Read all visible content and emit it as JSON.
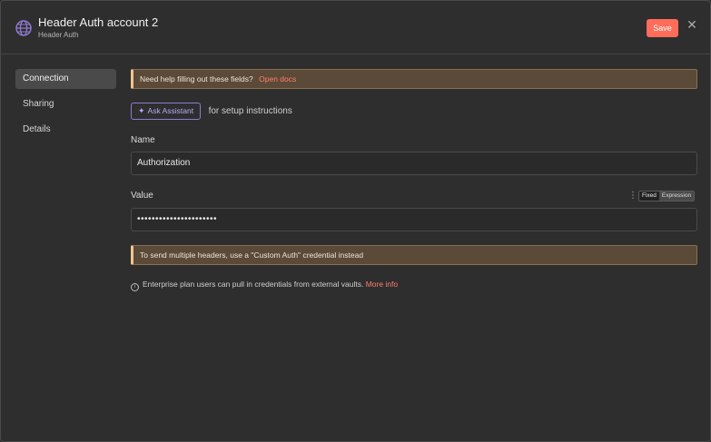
{
  "header": {
    "title": "Header Auth account 2",
    "subtitle": "Header Auth",
    "save_label": "Save",
    "icon": "globe-icon",
    "close_icon": "close-icon"
  },
  "sidebar": {
    "items": [
      {
        "label": "Connection",
        "active": true
      },
      {
        "label": "Sharing",
        "active": false
      },
      {
        "label": "Details",
        "active": false
      }
    ]
  },
  "notice": {
    "text": "Need help filling out these fields?",
    "link": "Open docs"
  },
  "assistant": {
    "button_label": "Ask Assistant",
    "suffix": "for setup instructions"
  },
  "fields": {
    "name_label": "Name",
    "name_value": "Authorization",
    "value_label": "Value",
    "value_masked": "••••••••••••••••••••••",
    "mode_fixed": "Fixed",
    "mode_expression": "Expression"
  },
  "warning": {
    "text": "To send multiple headers, use a \"Custom Auth\" credential instead"
  },
  "enterprise": {
    "text": "Enterprise plan users can pull in credentials from external vaults.",
    "link": "More info"
  },
  "colors": {
    "accent": "#ff6d5a",
    "assistant": "#8d7ad1",
    "notice_border": "#f0c690"
  }
}
